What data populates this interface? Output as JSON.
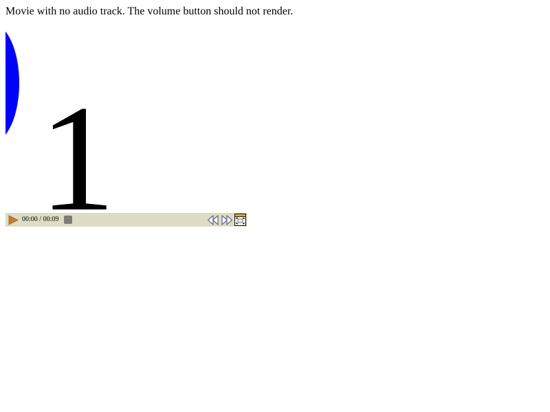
{
  "page": {
    "description": "Movie with no audio track. The volume button should not render."
  },
  "video": {
    "frame_text": "1",
    "colors": {
      "shape": "#0000ff",
      "number": "#000000"
    }
  },
  "controls": {
    "current_time": "00:00",
    "separator": "/",
    "duration": "00:09",
    "play_icon": "play-icon",
    "rewind_icon": "rewind-icon",
    "forward_icon": "fast-forward-icon",
    "fullscreen_icon": "fullscreen-icon",
    "colors": {
      "bar": "#dddcc4",
      "play": "#c47c35",
      "thumb": "#7b7b7b",
      "button_outline": "#5a5a7c",
      "fullscreen_bg": "#f5f5f5"
    }
  }
}
